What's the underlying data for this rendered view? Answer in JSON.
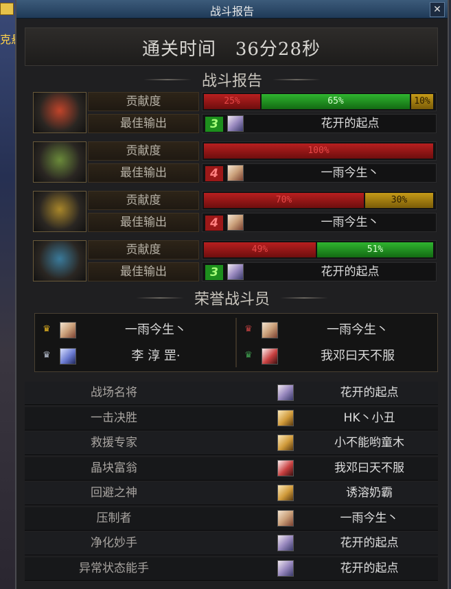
{
  "window": {
    "title": "战斗报告",
    "close": "✕"
  },
  "background": {
    "side_text": "克悬"
  },
  "summary": {
    "clear_time_label": "通关时间",
    "clear_time_value": "36分28秒"
  },
  "report_section": {
    "title": "战斗报告"
  },
  "row_labels": {
    "contribution": "贡献度",
    "best_output": "最佳输出"
  },
  "teams": [
    {
      "emblem": "red-flame-emblem",
      "emblem_color": "#c0442a",
      "contribution": [
        {
          "label": "25%",
          "value": 25,
          "color": "red"
        },
        {
          "label": "65%",
          "value": 65,
          "color": "green"
        },
        {
          "label": "10%",
          "value": 10,
          "color": "gold"
        }
      ],
      "best": {
        "rank": "3",
        "rank_color": "green",
        "player": "花开的起点",
        "avatar": "b"
      }
    },
    {
      "emblem": "green-thorn-emblem",
      "emblem_color": "#6a8a3a",
      "contribution": [
        {
          "label": "100%",
          "value": 100,
          "color": "red"
        }
      ],
      "best": {
        "rank": "4",
        "rank_color": "red",
        "player": "一雨今生丶",
        "avatar": "a"
      }
    },
    {
      "emblem": "gold-spike-emblem",
      "emblem_color": "#a8862a",
      "contribution": [
        {
          "label": "70%",
          "value": 70,
          "color": "red"
        },
        {
          "label": "30%",
          "value": 30,
          "color": "gold"
        }
      ],
      "best": {
        "rank": "4",
        "rank_color": "red",
        "player": "一雨今生丶",
        "avatar": "a"
      }
    },
    {
      "emblem": "blue-wing-emblem",
      "emblem_color": "#3a7a9a",
      "contribution": [
        {
          "label": "49%",
          "value": 49,
          "color": "red"
        },
        {
          "label": "51%",
          "value": 51,
          "color": "green"
        }
      ],
      "best": {
        "rank": "3",
        "rank_color": "green",
        "player": "花开的起点",
        "avatar": "b"
      }
    }
  ],
  "honor_section": {
    "title": "荣誉战斗员"
  },
  "honor_players": [
    {
      "name": "一雨今生丶",
      "avatar": "a",
      "crown": "crown-gold-icon"
    },
    {
      "name": "一雨今生丶",
      "avatar": "a",
      "crown": "crown-red-icon"
    },
    {
      "name": "李 淳 罡·",
      "avatar": "e",
      "crown": "crown-silver-icon"
    },
    {
      "name": "我邓曰天不服",
      "avatar": "c",
      "crown": "crown-green-icon"
    }
  ],
  "awards": [
    {
      "title": "战场名将",
      "player": "花开的起点",
      "avatar": "b"
    },
    {
      "title": "一击决胜",
      "player": "HK丶小丑",
      "avatar": "d"
    },
    {
      "title": "救援专家",
      "player": "小不能哟童木",
      "avatar": "d"
    },
    {
      "title": "晶块富翁",
      "player": "我邓曰天不服",
      "avatar": "c"
    },
    {
      "title": "回避之神",
      "player": "诱溶奶霸",
      "avatar": "d"
    },
    {
      "title": "压制者",
      "player": "一雨今生丶",
      "avatar": "a"
    },
    {
      "title": "净化妙手",
      "player": "花开的起点",
      "avatar": "b"
    },
    {
      "title": "异常状态能手",
      "player": "花开的起点",
      "avatar": "b"
    }
  ]
}
